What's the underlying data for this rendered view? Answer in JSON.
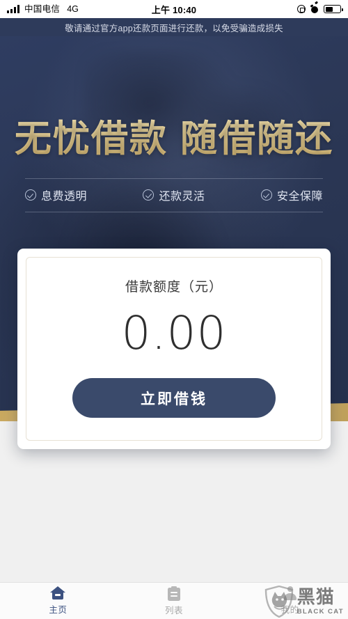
{
  "status_bar": {
    "carrier": "中国电信",
    "network": "4G",
    "time": "上午 10:40",
    "icons": [
      "signal-bars-icon",
      "rotation-lock-icon",
      "alarm-clock-icon",
      "battery-icon"
    ],
    "battery_level_percent": 52
  },
  "notice": {
    "text": "敬请通过官方app还款页面进行还款，以免受骗造成损失",
    "background_color": "#2e3b5b",
    "text_color": "#d8dce8"
  },
  "hero": {
    "headline_left": "无忧借款",
    "headline_right": "随借随还",
    "gold_color": "#efd89c",
    "background_color": "#2b3755",
    "features": [
      {
        "label": "息费透明",
        "icon": "check-circle-icon"
      },
      {
        "label": "还款灵活",
        "icon": "check-circle-icon"
      },
      {
        "label": "安全保障",
        "icon": "check-circle-icon"
      }
    ]
  },
  "card": {
    "title": "借款额度（元）",
    "amount": "0.00",
    "button_label": "立即借钱",
    "button_color": "#3a4a6b"
  },
  "tabbar": {
    "items": [
      {
        "label": "主页",
        "icon": "home-icon",
        "active": true
      },
      {
        "label": "列表",
        "icon": "clipboard-list-icon",
        "active": false
      },
      {
        "label": "我的",
        "icon": "user-profile-icon",
        "active": false
      }
    ],
    "active_color": "#3c5180",
    "inactive_color": "#a8a8a8"
  },
  "watermark": {
    "cn": "黑猫",
    "en": "BLACK CAT",
    "icon": "black-cat-shield-logo"
  }
}
